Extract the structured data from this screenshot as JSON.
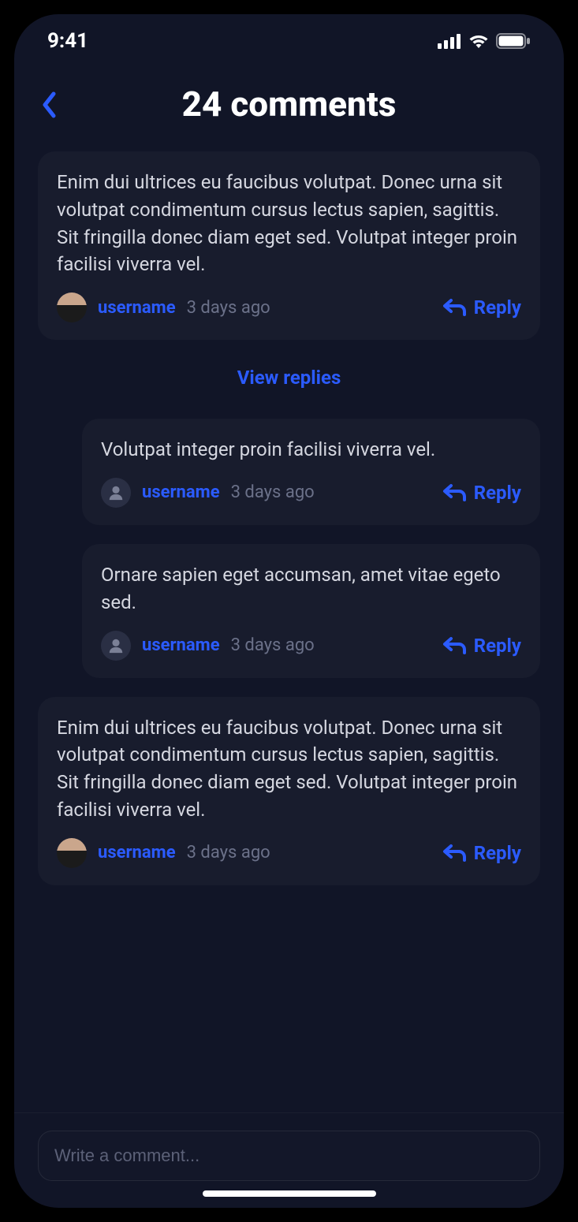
{
  "status": {
    "time": "9:41"
  },
  "header": {
    "title": "24 comments"
  },
  "viewReplies": "View replies",
  "replyLabel": "Reply",
  "comments": [
    {
      "body": "Enim dui ultrices eu faucibus volutpat. Donec urna sit volutpat condimentum cursus lectus sapien, sagittis. Sit fringilla donec diam eget sed. Volutpat integer proin facilisi viverra vel.",
      "username": "username",
      "timestamp": "3 days ago",
      "avatar": "photo"
    },
    {
      "body": "Enim dui ultrices eu faucibus volutpat. Donec urna sit volutpat condimentum cursus lectus sapien, sagittis. Sit fringilla donec diam eget sed. Volutpat integer proin facilisi viverra vel.",
      "username": "username",
      "timestamp": "3 days ago",
      "avatar": "photo"
    }
  ],
  "replies": [
    {
      "body": "Volutpat integer proin facilisi viverra vel.",
      "username": "username",
      "timestamp": "3 days ago",
      "avatar": "placeholder"
    },
    {
      "body": "Ornare sapien eget accumsan, amet vitae egeto sed.",
      "username": "username",
      "timestamp": "3 days ago",
      "avatar": "placeholder"
    }
  ],
  "composer": {
    "placeholder": "Write a comment..."
  },
  "icons": {
    "back": "chevron-left",
    "reply": "reply-arrow",
    "signal": "cell-signal",
    "wifi": "wifi",
    "battery": "battery"
  },
  "colors": {
    "background": "#111527",
    "card": "rgba(255,255,255,0.033)",
    "accent": "#2b5bff",
    "text": "#d5d7e0",
    "muted": "#6b7189"
  }
}
